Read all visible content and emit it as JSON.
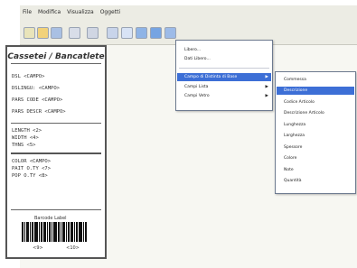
{
  "menubar": {
    "items": [
      "File",
      "Modifica",
      "Visualizza",
      "Oggetti"
    ]
  },
  "label": {
    "title": "Cassetei / Bancatlete",
    "fields": [
      "DSL <CAMPO>",
      "DSLINGU: <CAMPO>",
      "PARS CODE <CAMPO>",
      "PARS DESCR <CAMPO>",
      "LENGTH <2>",
      "WIDTH <4>",
      "THNS <5>",
      "COLOR <CAMPO>",
      "PAIT O.TY <7>",
      "POP O.TY <8>"
    ],
    "barcode_title": "Barcode Label",
    "barcode_left": "<9>",
    "barcode_right": "<10>"
  },
  "menu_main": {
    "items": [
      "Libero...",
      "Dati Libero..."
    ]
  },
  "menu_fields": {
    "items": [
      "Campo di Distinta di Base",
      "Campi Lista",
      "Campi Vetro"
    ]
  },
  "menu_sub": {
    "items": [
      "Commessa",
      "Descrizione",
      "Codice Articolo",
      "Descrizione Articolo",
      "Lunghezza",
      "Larghezza",
      "Spessore",
      "Colore",
      "Note",
      "Quantità"
    ]
  }
}
